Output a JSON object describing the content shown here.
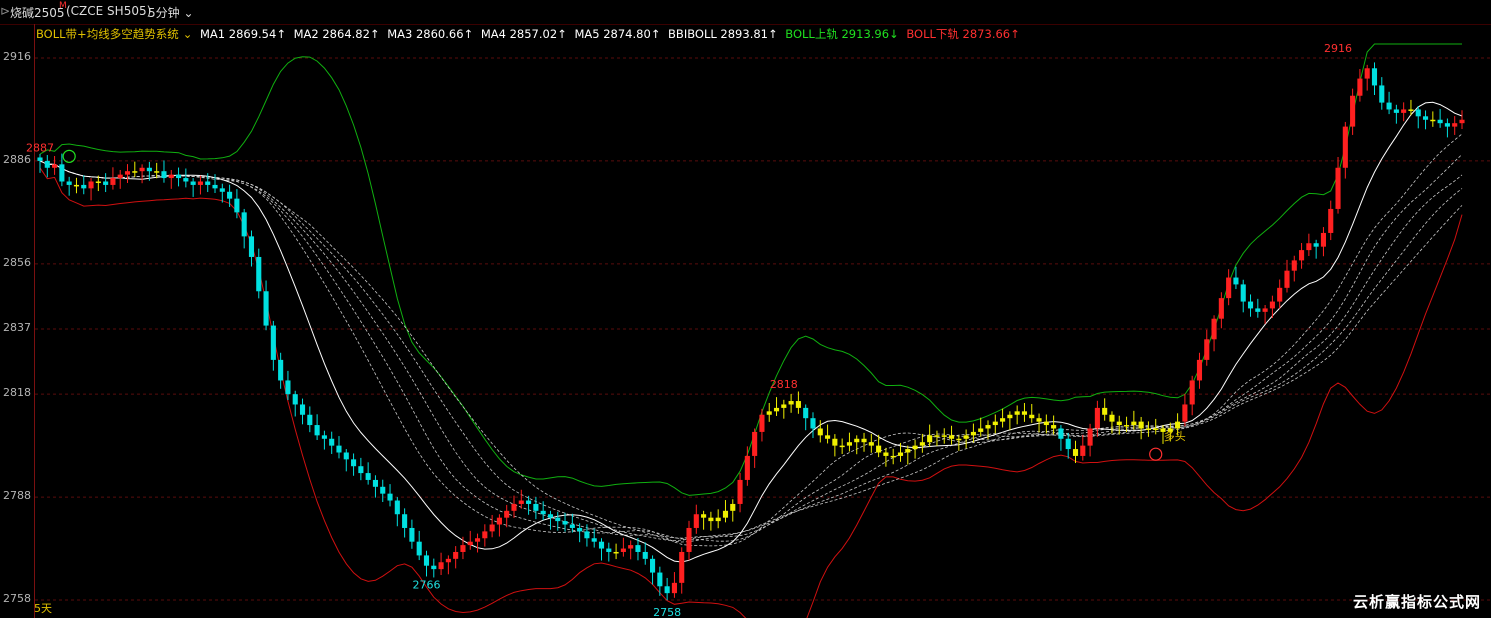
{
  "header": {
    "instrument": "烧碱2505",
    "badge": "M",
    "code": "(CZCE SH505)",
    "period": "5分钟",
    "chevron_icon": "chevron-down-icon"
  },
  "legend": {
    "system_name": "BOLL带+均线多空趋势系统",
    "ma1": "MA1 2869.54↑",
    "ma2": "MA2 2864.82↑",
    "ma3": "MA3 2860.66↑",
    "ma4": "MA4 2857.02↑",
    "ma5": "MA5 2874.80↑",
    "bbiboll": "BBIBOLL 2893.81↑",
    "boll_upper": "BOLL上轨 2913.96↓",
    "boll_lower": "BOLL下轨 2873.66↑",
    "colors": {
      "system": "#e0c000",
      "ma": "#ffffff",
      "upper": "#20e020",
      "lower": "#ff3030"
    }
  },
  "footer": {
    "period_label": "5天",
    "watermark": "云析赢指标公式网"
  },
  "chart_data": {
    "type": "candlestick",
    "y_ticks": [
      2916,
      2886,
      2856,
      2837,
      2818,
      2788,
      2758
    ],
    "ylim": [
      2752,
      2926
    ],
    "grid": true,
    "colors": {
      "up": "#ff2020",
      "down": "#00e0e0",
      "neutral": "#f0f000",
      "mid": "#ffffff",
      "upper": "#10b010",
      "lower": "#d01010",
      "ma": "#c8c8c8"
    },
    "annotations": [
      {
        "label": "2887",
        "index": 0,
        "value": 2887,
        "color": "#ff3030",
        "pos": "above"
      },
      {
        "label": "2766",
        "index": 53,
        "value": 2766,
        "color": "#20e0e0",
        "pos": "below"
      },
      {
        "label": "2758",
        "index": 86,
        "value": 2758,
        "color": "#20e0e0",
        "pos": "below"
      },
      {
        "label": "2818",
        "index": 102,
        "value": 2818,
        "color": "#ff3030",
        "pos": "above"
      },
      {
        "label": "2916",
        "index": 178,
        "value": 2916,
        "color": "#ff3030",
        "pos": "above"
      }
    ],
    "signals": [
      {
        "label": "",
        "index": 4,
        "value": 2885,
        "color": "#20e020",
        "kind": "circle"
      },
      {
        "label": "多头",
        "index": 153,
        "value": 2804,
        "color": "#ff3030",
        "kind": "circle"
      }
    ],
    "closes": [
      2886,
      2884,
      2885,
      2880,
      2879,
      2879,
      2878,
      2880,
      2880,
      2879,
      2881,
      2882,
      2883,
      2883,
      2884,
      2883,
      2883,
      2881,
      2882,
      2881,
      2880,
      2879,
      2880,
      2879,
      2878,
      2877,
      2875,
      2871,
      2864,
      2858,
      2848,
      2838,
      2828,
      2822,
      2818,
      2815,
      2812,
      2809,
      2806,
      2805,
      2803,
      2801,
      2799,
      2797,
      2795,
      2793,
      2791,
      2789,
      2787,
      2783,
      2779,
      2775,
      2771,
      2768,
      2767,
      2769,
      2770,
      2772,
      2774,
      2775,
      2776,
      2778,
      2780,
      2782,
      2784,
      2786,
      2787,
      2786,
      2784,
      2783,
      2782,
      2781,
      2780,
      2779,
      2778,
      2776,
      2775,
      2773,
      2772,
      2772,
      2773,
      2774,
      2772,
      2770,
      2766,
      2762,
      2760,
      2763,
      2772,
      2779,
      2783,
      2782,
      2781,
      2782,
      2784,
      2786,
      2793,
      2800,
      2807,
      2812,
      2813,
      2814,
      2815,
      2816,
      2814,
      2811,
      2808,
      2806,
      2805,
      2803,
      2803,
      2804,
      2805,
      2804,
      2803,
      2801,
      2800,
      2800,
      2801,
      2802,
      2803,
      2804,
      2806,
      2806,
      2806,
      2805,
      2805,
      2806,
      2807,
      2808,
      2809,
      2810,
      2811,
      2812,
      2813,
      2812,
      2811,
      2810,
      2809,
      2808,
      2805,
      2802,
      2800,
      2803,
      2808,
      2814,
      2812,
      2810,
      2809,
      2809,
      2810,
      2808,
      2808,
      2808,
      2807,
      2808,
      2810,
      2815,
      2822,
      2828,
      2834,
      2840,
      2846,
      2852,
      2850,
      2845,
      2843,
      2842,
      2843,
      2845,
      2849,
      2854,
      2857,
      2860,
      2862,
      2861,
      2865,
      2872,
      2884,
      2896,
      2905,
      2910,
      2913,
      2908,
      2903,
      2901,
      2900,
      2901,
      2901,
      2899,
      2898,
      2898,
      2897,
      2896,
      2897,
      2898
    ]
  }
}
